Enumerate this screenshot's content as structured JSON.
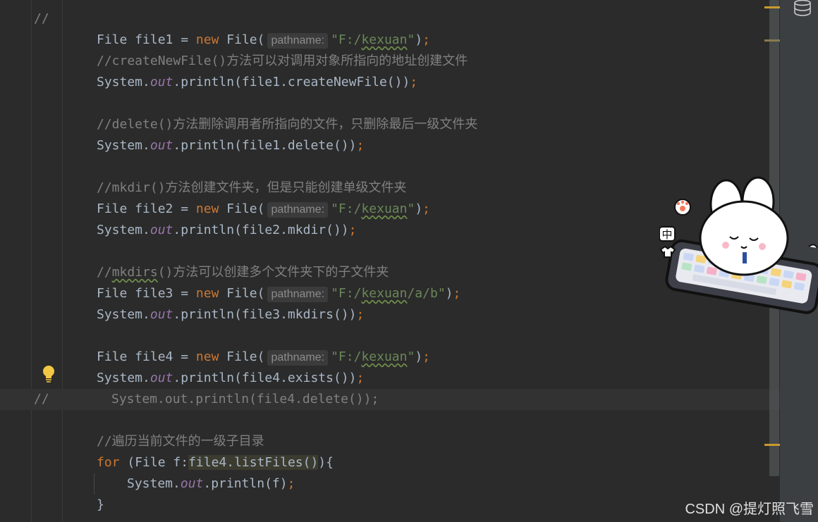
{
  "gutter": {
    "comment_marker_top": "//",
    "comment_marker_current": "//"
  },
  "lines": {
    "l1": {
      "type_kw": "File",
      "var": "file1",
      "eq": "=",
      "new": "new",
      "cls": "File(",
      "hint": "pathname:",
      "str_q1": "\"",
      "str_path": "F:/",
      "str_path_u": "kexuan",
      "str_q2": "\"",
      "close": ")",
      "semi": ";"
    },
    "l2": {
      "text": "//createNewFile()方法可以对调用对象所指向的地址创建文件"
    },
    "l3": {
      "sys": "System.",
      "out": "out",
      "rest": ".println(file1.createNewFile())",
      "semi": ";"
    },
    "l5": {
      "text": "//delete()方法删除调用者所指向的文件，只删除最后一级文件夹"
    },
    "l6": {
      "sys": "System.",
      "out": "out",
      "rest": ".println(file1.delete())",
      "semi": ";"
    },
    "l8": {
      "text": "//mkdir()方法创建文件夹，但是只能创建单级文件夹"
    },
    "l9": {
      "type_kw": "File",
      "var": "file2",
      "eq": "=",
      "new": "new",
      "cls": "File(",
      "hint": "pathname:",
      "str_q1": "\"",
      "str_path": "F:/",
      "str_path_u": "kexuan",
      "str_q2": "\"",
      "close": ")",
      "semi": ";"
    },
    "l10": {
      "sys": "System.",
      "out": "out",
      "rest": ".println(file2.mkdir())",
      "semi": ";"
    },
    "l12": {
      "prefix": "//",
      "underlined": "mkdirs",
      "text": "()方法可以创建多个文件夹下的子文件夹"
    },
    "l13": {
      "type_kw": "File",
      "var": "file3",
      "eq": "=",
      "new": "new",
      "cls": "File(",
      "hint": "pathname:",
      "str_q1": "\"",
      "str_path": "F:/",
      "str_path_u": "kexuan",
      "str_tail": "/a/b",
      "str_q2": "\"",
      "close": ")",
      "semi": ";"
    },
    "l14": {
      "sys": "System.",
      "out": "out",
      "rest": ".println(file3.mkdirs())",
      "semi": ";"
    },
    "l16": {
      "type_kw": "File",
      "var": "file4",
      "eq": "=",
      "new": "new",
      "cls": "File(",
      "hint": "pathname:",
      "str_q1": "\"",
      "str_path": "F:/",
      "str_path_u": "kexuan",
      "str_q2": "\"",
      "close": ")",
      "semi": ";"
    },
    "l17": {
      "sys": "System.",
      "out": "out",
      "rest": ".println(file4.exists())",
      "semi": ";"
    },
    "l18": {
      "text": "System.out.println(file4.delete());"
    },
    "l20": {
      "text": "//遍历当前文件的一级子目录"
    },
    "l21": {
      "for": "for",
      "open": "(File f:",
      "hl": "file4.listFiles()",
      "close": "){"
    },
    "l22": {
      "sys": "System.",
      "out": "out",
      "rest": ".println(f)",
      "semi": ";"
    },
    "l23": {
      "brace": "}"
    }
  },
  "sticker": {
    "label_zhong": "中"
  },
  "watermark": {
    "text": "CSDN @提灯照飞雪"
  },
  "colors": {
    "background": "#2b2b2b",
    "keyword": "#cc7832",
    "string": "#6a8759",
    "comment": "#808080",
    "field": "#9876aa",
    "default": "#a9b7c6",
    "stripe_marker": "#c99a2e"
  },
  "icons": {
    "bulb": "lightbulb-icon",
    "database": "database-icon"
  }
}
